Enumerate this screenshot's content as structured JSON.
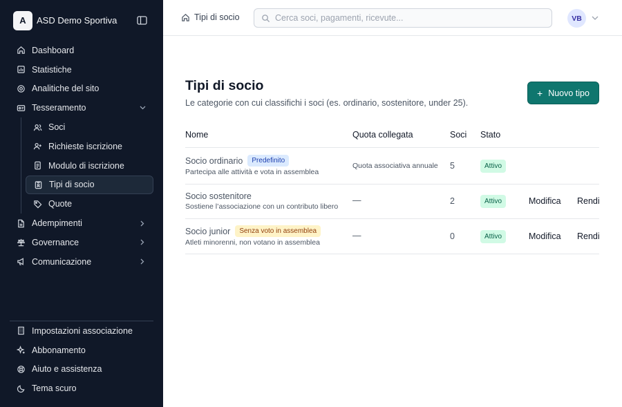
{
  "sidebar": {
    "brand": {
      "initial": "A",
      "name": "ASD Demo Sportiva"
    },
    "items": [
      {
        "label": "Dashboard",
        "icon": "home-icon"
      },
      {
        "label": "Statistiche",
        "icon": "chart-icon"
      },
      {
        "label": "Analitiche del sito",
        "icon": "analytics-icon"
      },
      {
        "label": "Tesseramento",
        "icon": "id-card-icon",
        "expanded": true
      }
    ],
    "subitems": [
      {
        "label": "Soci",
        "icon": "users-icon"
      },
      {
        "label": "Richieste iscrizione",
        "icon": "user-plus-icon"
      },
      {
        "label": "Modulo di iscrizione",
        "icon": "form-icon"
      },
      {
        "label": "Tipi di socio",
        "icon": "id-badge-icon",
        "active": true
      },
      {
        "label": "Quote",
        "icon": "tag-icon"
      }
    ],
    "more_items": [
      {
        "label": "Adempimenti",
        "icon": "file-icon"
      },
      {
        "label": "Governance",
        "icon": "scale-icon"
      },
      {
        "label": "Comunicazione",
        "icon": "megaphone-icon"
      }
    ],
    "bottom_items": [
      {
        "label": "Impostazioni associazione",
        "icon": "building-icon"
      },
      {
        "label": "Abbonamento",
        "icon": "sparkles-icon"
      },
      {
        "label": "Aiuto e assistenza",
        "icon": "lifebuoy-icon"
      },
      {
        "label": "Tema scuro",
        "icon": "moon-icon"
      }
    ]
  },
  "topbar": {
    "breadcrumb": "Tipi di socio",
    "search_placeholder": "Cerca soci, pagamenti, ricevute...",
    "avatar": "VB"
  },
  "main": {
    "title": "Tipi di socio",
    "subtitle": "Le categorie con cui classifichi i soci (es. ordinario, sostenitore, under 25).",
    "new_button": "Nuovo tipo",
    "columns": {
      "name": "Nome",
      "quota": "Quota collegata",
      "members": "Soci",
      "status": "Stato"
    },
    "rows": [
      {
        "name": "Socio ordinario",
        "badge": "Predefinito",
        "description": "Partecipa alle attività e vota in assemblea",
        "quota": "Quota associativa annuale",
        "members": "5",
        "status": "Attivo",
        "actions": []
      },
      {
        "name": "Socio sostenitore",
        "badge": "",
        "description": "Sostiene l’associazione con un contributo libero",
        "quota": "—",
        "members": "2",
        "status": "Attivo",
        "actions": [
          "Modifica",
          "Rendi"
        ]
      },
      {
        "name": "Socio junior",
        "badge": "Senza voto in assemblea",
        "description": "Atleti minorenni, non votano in assemblea",
        "quota": "—",
        "members": "0",
        "status": "Attivo",
        "actions": [
          "Modifica",
          "Rendi"
        ]
      }
    ]
  },
  "colors": {
    "sidebar_bg": "#101828",
    "accent": "#0f766e",
    "status_bg": "#d1fae5"
  }
}
